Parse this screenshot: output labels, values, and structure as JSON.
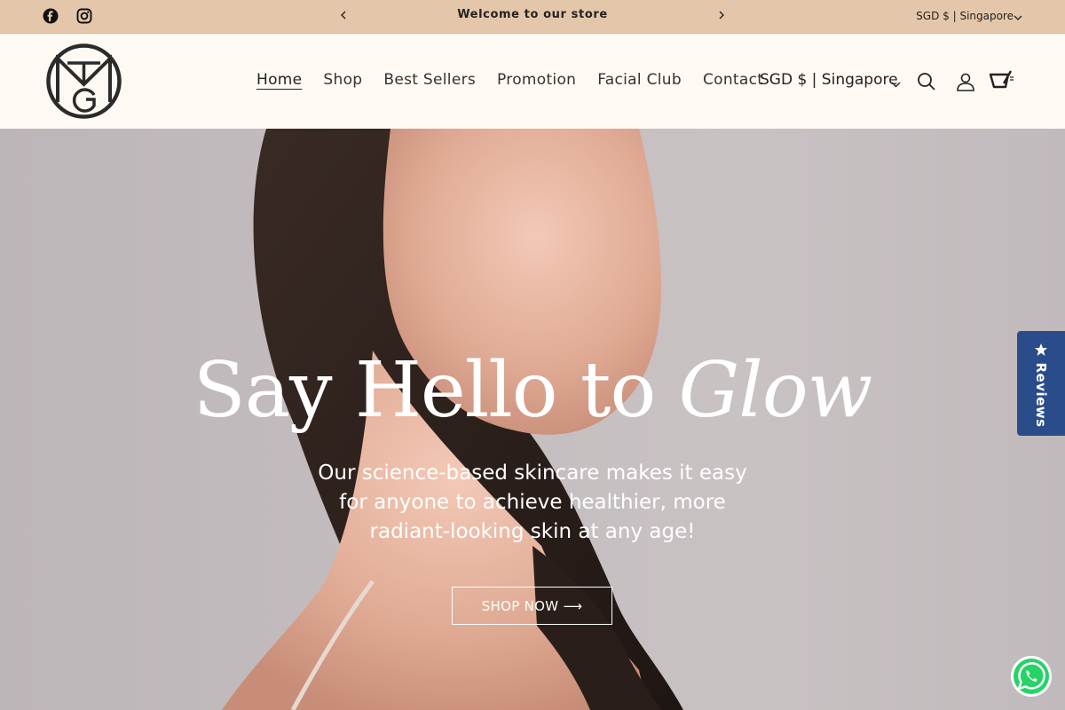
{
  "announcement": {
    "message": "Welcome to our store",
    "currency": "SGD $ | Singapore",
    "prev_icon": "chevron-left-icon",
    "next_icon": "chevron-right-icon",
    "social": [
      "facebook-icon",
      "instagram-icon"
    ]
  },
  "header": {
    "logo_letters": "MTG",
    "nav": [
      {
        "label": "Home",
        "active": true
      },
      {
        "label": "Shop"
      },
      {
        "label": "Best Sellers"
      },
      {
        "label": "Promotion"
      },
      {
        "label": "Facial Club"
      },
      {
        "label": "Contact"
      }
    ],
    "currency": "SGD $ | Singapore",
    "icons": [
      "search-icon",
      "account-icon",
      "cart-icon"
    ]
  },
  "hero": {
    "heading_main": "Say Hello to ",
    "heading_italic": "Glow",
    "subtitle": "Our science-based skincare makes it easy for anyone to achieve healthier, more radiant-looking skin at any age!",
    "cta_label": "SHOP NOW ⟶"
  },
  "widgets": {
    "reviews_label": "Reviews",
    "whatsapp_icon": "whatsapp-icon"
  },
  "colors": {
    "announcement_bg": "#e4c7aa",
    "header_bg": "#fef9f2",
    "reviews_bg": "#2a4c8a",
    "whatsapp_green": "#25d366"
  }
}
